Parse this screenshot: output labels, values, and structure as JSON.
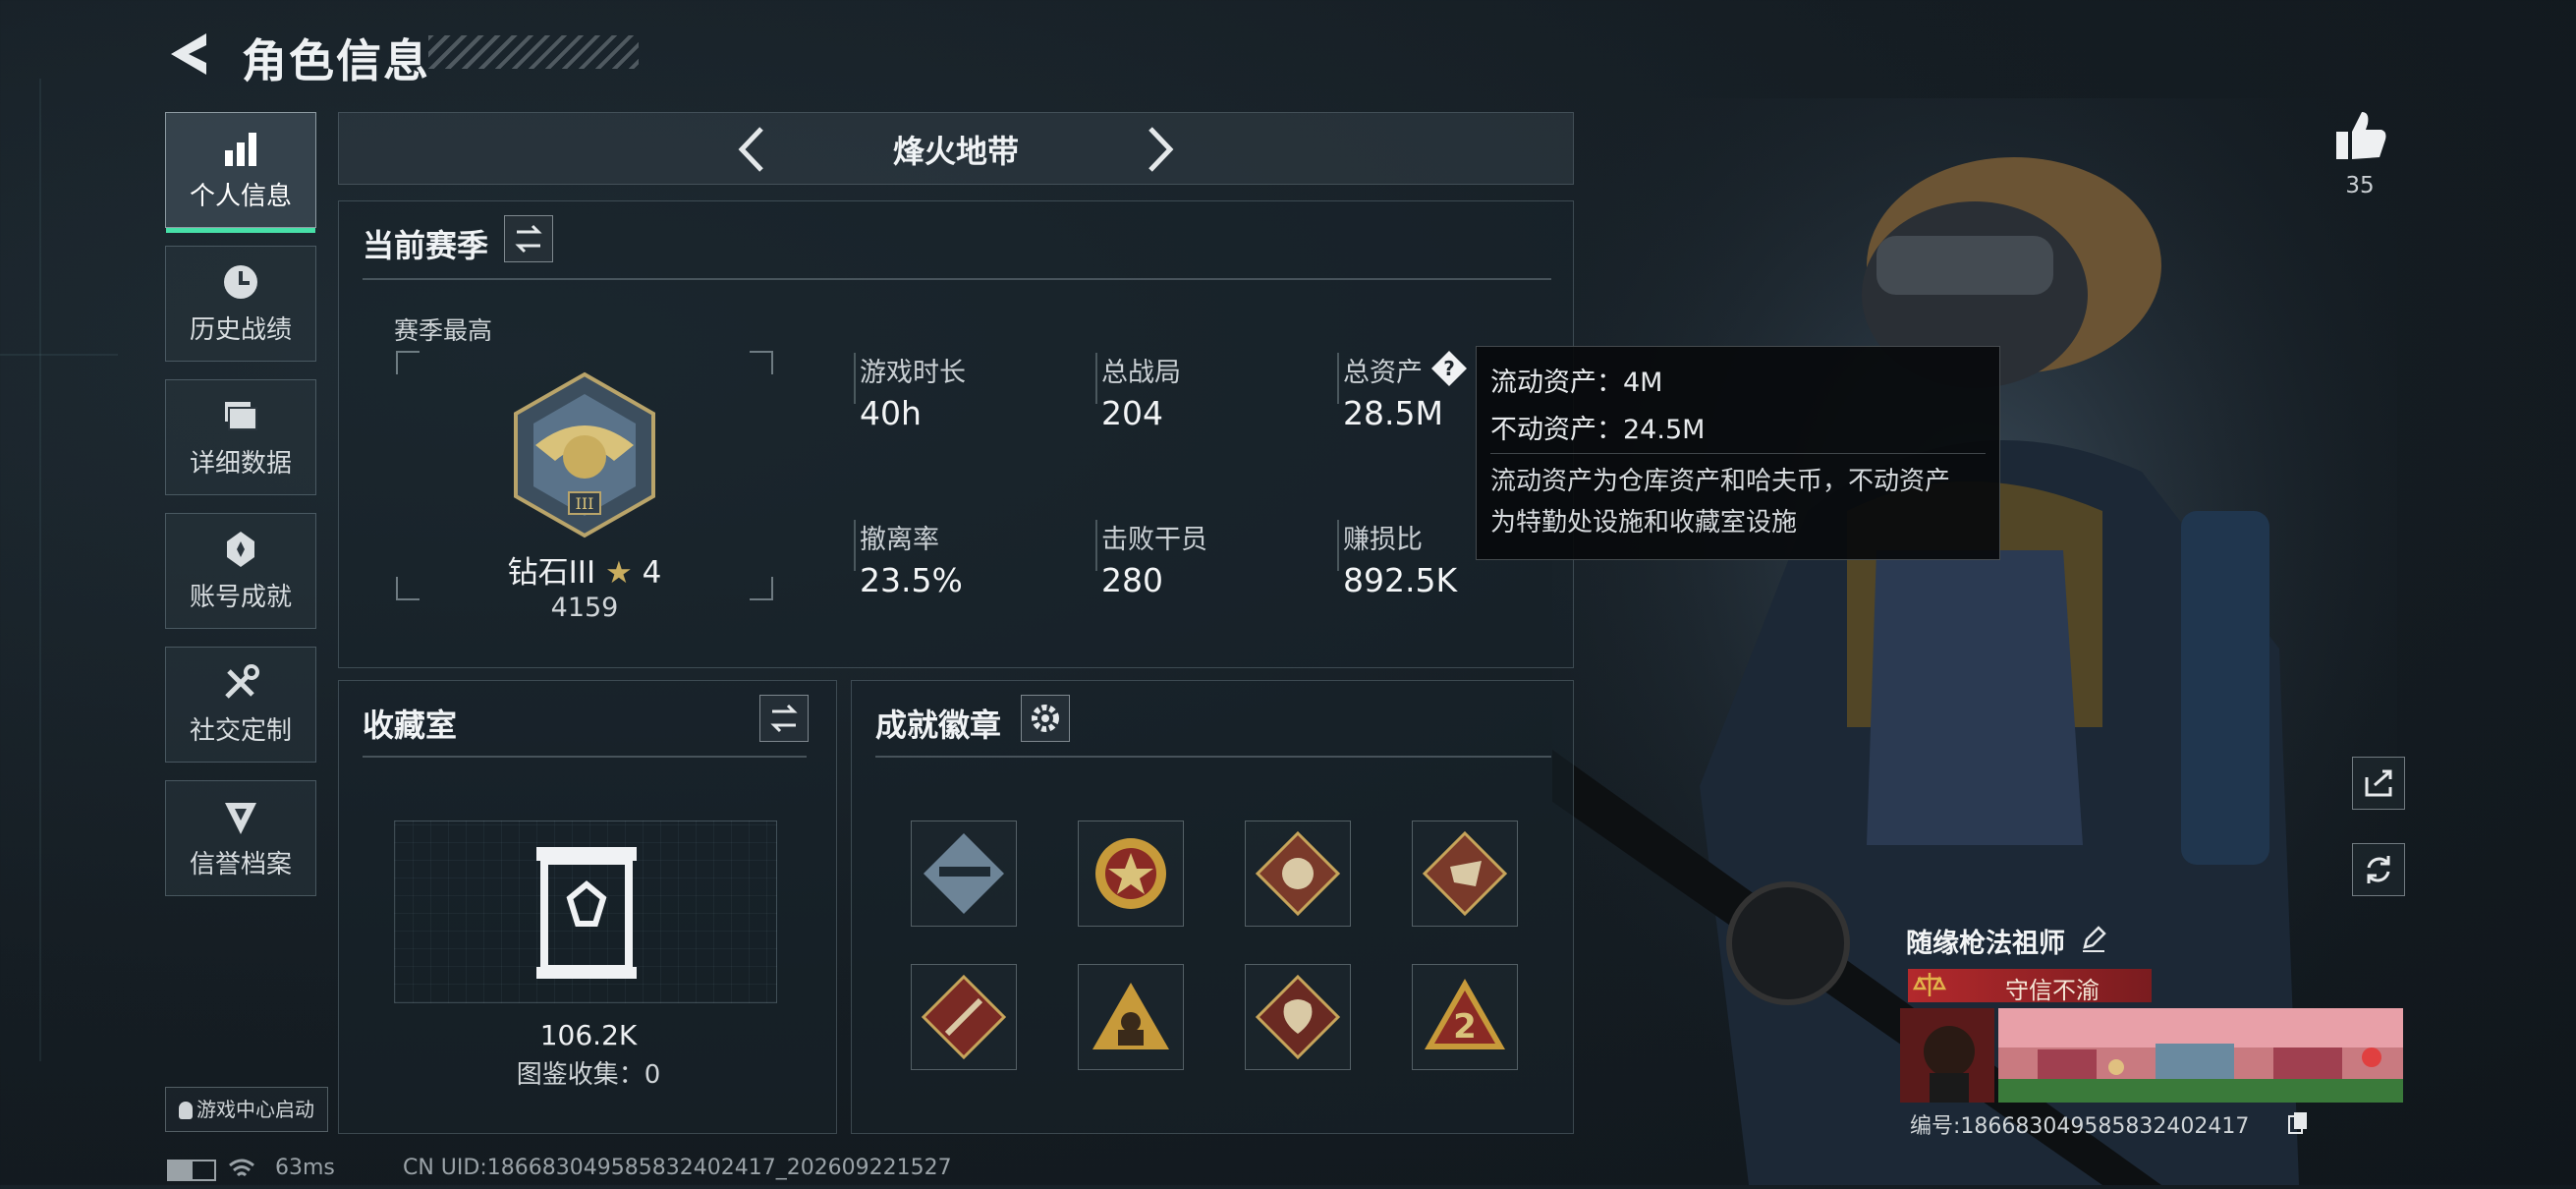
{
  "header": {
    "title": "角色信息"
  },
  "sidebar": {
    "items": [
      {
        "label": "个人信息",
        "icon": "bar-chart-icon",
        "active": true
      },
      {
        "label": "历史战绩",
        "icon": "clock-icon"
      },
      {
        "label": "详细数据",
        "icon": "stack-icon"
      },
      {
        "label": "账号成就",
        "icon": "achievement-icon"
      },
      {
        "label": "社交定制",
        "icon": "tools-icon"
      },
      {
        "label": "信誉档案",
        "icon": "shield-icon"
      }
    ],
    "launch_label": "游戏中心启动"
  },
  "mode_selector": {
    "label": "烽火地带"
  },
  "season": {
    "title": "当前赛季",
    "best_label": "赛季最高",
    "rank_name": "钻石III",
    "rank_stars": "4",
    "rank_score": "4159",
    "stats": [
      {
        "label": "游戏时长",
        "value": "40h"
      },
      {
        "label": "总战局",
        "value": "204"
      },
      {
        "label": "总资产",
        "value": "28.5M"
      },
      {
        "label": "撤离率",
        "value": "23.5%"
      },
      {
        "label": "击败干员",
        "value": "280"
      },
      {
        "label": "赚损比",
        "value": "892.5K"
      }
    ]
  },
  "tooltip": {
    "liquid": "流动资产：4M",
    "fixed": "不动资产：24.5M",
    "desc_line1": "流动资产为仓库资产和哈夫币，不动资产",
    "desc_line2": "为特勤处设施和收藏室设施"
  },
  "collection": {
    "title": "收藏室",
    "value": "106.2K",
    "codex_label": "图鉴收集：0"
  },
  "achievements": {
    "title": "成就徽章"
  },
  "likes": {
    "count": "35"
  },
  "player": {
    "name": "随缘枪法祖师",
    "credit_tag": "守信不渝",
    "id_label": "编号:18668304958583240​2417"
  },
  "status": {
    "ping": "63ms",
    "uid": "CN UID:18668304958583240​2417_202609221527"
  },
  "colors": {
    "accent": "#47e0a8",
    "credit_red": "#8a1f22",
    "panel_border": "#5a6a72"
  }
}
